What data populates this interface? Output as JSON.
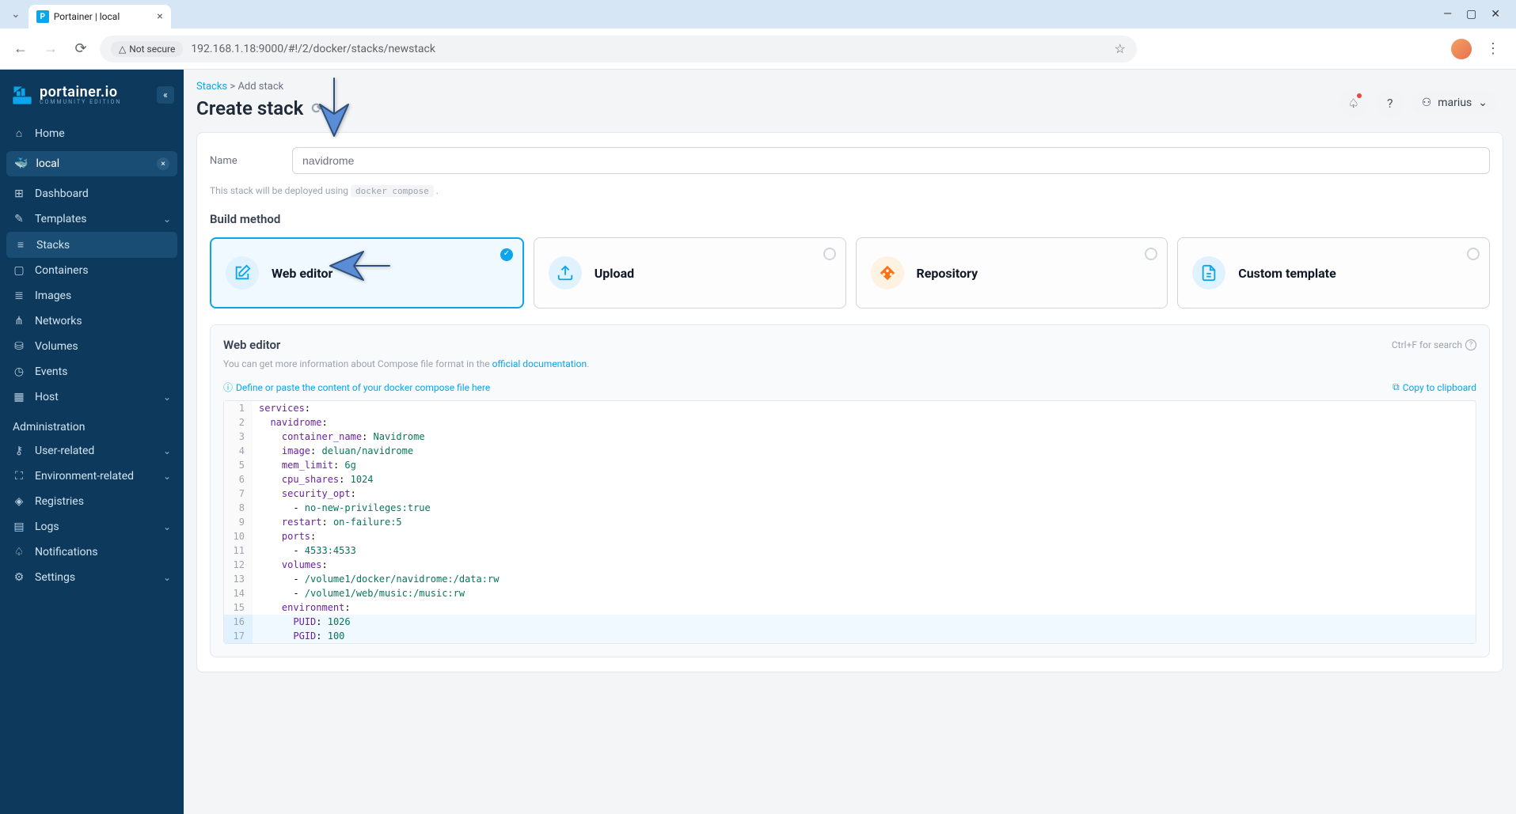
{
  "browser": {
    "tab_title": "Portainer | local",
    "url": "192.168.1.18:9000/#!/2/docker/stacks/newstack",
    "security_label": "Not secure"
  },
  "logo": {
    "name": "portainer.io",
    "edition": "COMMUNITY EDITION"
  },
  "sidebar": {
    "home": "Home",
    "env": "local",
    "items": [
      {
        "icon": "⊞",
        "label": "Dashboard"
      },
      {
        "icon": "✎",
        "label": "Templates",
        "chevron": true
      },
      {
        "icon": "≡",
        "label": "Stacks",
        "active": true
      },
      {
        "icon": "▢",
        "label": "Containers"
      },
      {
        "icon": "≣",
        "label": "Images"
      },
      {
        "icon": "⋔",
        "label": "Networks"
      },
      {
        "icon": "⛁",
        "label": "Volumes"
      },
      {
        "icon": "◷",
        "label": "Events"
      },
      {
        "icon": "▦",
        "label": "Host",
        "chevron": true
      }
    ],
    "admin_label": "Administration",
    "admin_items": [
      {
        "icon": "⚷",
        "label": "User-related",
        "chevron": true
      },
      {
        "icon": "⛶",
        "label": "Environment-related",
        "chevron": true
      },
      {
        "icon": "◈",
        "label": "Registries"
      },
      {
        "icon": "▤",
        "label": "Logs",
        "chevron": true
      },
      {
        "icon": "♤",
        "label": "Notifications"
      },
      {
        "icon": "⚙",
        "label": "Settings",
        "chevron": true
      }
    ]
  },
  "breadcrumb": {
    "stacks": "Stacks",
    "sep": ">",
    "add": "Add stack"
  },
  "page_title": "Create stack",
  "user": "marius",
  "form": {
    "name_label": "Name",
    "name_value": "navidrome",
    "deploy_hint_pre": "This stack will be deployed using ",
    "deploy_hint_code": "docker compose",
    "deploy_hint_post": " ."
  },
  "build_method_label": "Build method",
  "tiles": {
    "web_editor": "Web editor",
    "upload": "Upload",
    "repository": "Repository",
    "custom_template": "Custom template"
  },
  "editor": {
    "title": "Web editor",
    "search_hint": "Ctrl+F for search",
    "info_pre": "You can get more information about Compose file format in the ",
    "info_link": "official documentation",
    "info_post": ".",
    "define_hint": "Define or paste the content of your docker compose file here",
    "copy_label": "Copy to clipboard"
  },
  "code": [
    {
      "n": 1,
      "text": "services:",
      "cls": ""
    },
    {
      "n": 2,
      "text": "  navidrome:",
      "cls": ""
    },
    {
      "n": 3,
      "text": "    container_name: Navidrome",
      "cls": ""
    },
    {
      "n": 4,
      "text": "    image: deluan/navidrome",
      "cls": ""
    },
    {
      "n": 5,
      "text": "    mem_limit: 6g",
      "cls": ""
    },
    {
      "n": 6,
      "text": "    cpu_shares: 1024",
      "cls": ""
    },
    {
      "n": 7,
      "text": "    security_opt:",
      "cls": ""
    },
    {
      "n": 8,
      "text": "      - no-new-privileges:true",
      "cls": ""
    },
    {
      "n": 9,
      "text": "    restart: on-failure:5",
      "cls": ""
    },
    {
      "n": 10,
      "text": "    ports:",
      "cls": ""
    },
    {
      "n": 11,
      "text": "      - 4533:4533",
      "cls": ""
    },
    {
      "n": 12,
      "text": "    volumes:",
      "cls": ""
    },
    {
      "n": 13,
      "text": "      - /volume1/docker/navidrome:/data:rw",
      "cls": ""
    },
    {
      "n": 14,
      "text": "      - /volume1/web/music:/music:rw",
      "cls": ""
    },
    {
      "n": 15,
      "text": "    environment:",
      "cls": ""
    },
    {
      "n": 16,
      "text": "      PUID: 1026",
      "cls": "hl"
    },
    {
      "n": 17,
      "text": "      PGID: 100",
      "cls": "hl"
    }
  ]
}
